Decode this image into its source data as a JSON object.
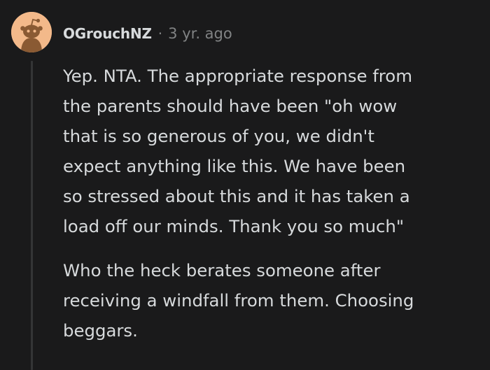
{
  "comment": {
    "username": "OGrouchNZ",
    "separator": "·",
    "timestamp": "3 yr. ago",
    "paragraphs": [
      {
        "lines": [
          "Yep. NTA. The appropriate response from",
          "the parents should have been \"oh wow",
          "that is so generous of you, we didn't",
          "expect anything like this. We have been",
          "so stressed about this and it has taken a",
          "load off our minds. Thank you so much\""
        ]
      },
      {
        "lines": [
          "Who the heck berates someone after",
          "receiving a windfall from them. Choosing",
          "beggars."
        ]
      }
    ]
  },
  "avatar": {
    "icon": "snoo-avatar-icon",
    "background_color": "#f3b98a"
  },
  "colors": {
    "background": "#1a1a1b",
    "text": "#d7dadc",
    "muted": "#818384",
    "thread_line": "#343536"
  }
}
